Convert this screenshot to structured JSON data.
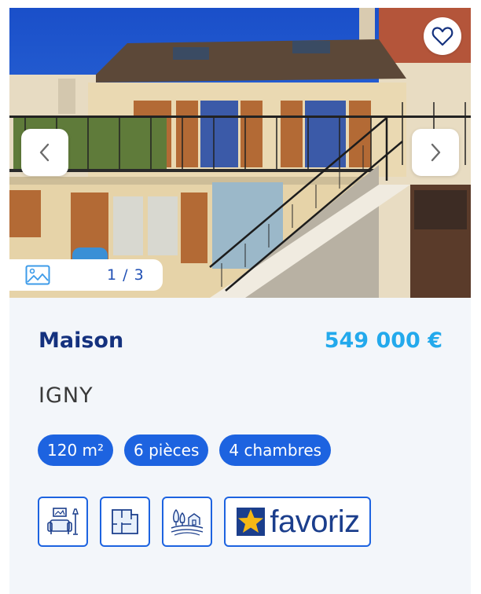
{
  "listing": {
    "type": "Maison",
    "price": "549 000 €",
    "city": "IGNY"
  },
  "gallery": {
    "counter": "1 / 3",
    "prev_icon": "chevron-left-icon",
    "next_icon": "chevron-right-icon",
    "gallery_icon": "image-gallery-icon",
    "favorite_icon": "heart-outline-icon"
  },
  "tags": [
    {
      "label": "120 m²"
    },
    {
      "label": "6 pièces"
    },
    {
      "label": "4 chambres"
    }
  ],
  "badges": {
    "icons": [
      "furnished-living-room-icon",
      "floor-plan-icon",
      "countryside-icon"
    ],
    "partner_logo": "favoriz"
  },
  "colors": {
    "title": "#14317e",
    "price": "#23a9ec",
    "tag_bg": "#1d63e0",
    "badge_border": "#1d63e0",
    "card_bg": "#f3f6fa"
  }
}
